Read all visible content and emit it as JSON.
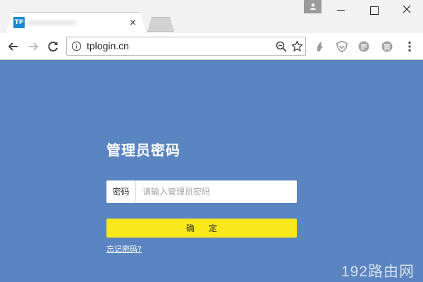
{
  "tab": {
    "favicon_text": "TP",
    "close_symbol": "×"
  },
  "window": {
    "profile_icon": "person-icon"
  },
  "address_bar": {
    "url": "tplogin.cn"
  },
  "page": {
    "title": "管理员密码",
    "password_label": "密码",
    "password_placeholder": "请输入管理员密码",
    "password_value": "",
    "confirm_label": "确定",
    "forgot_link": "忘记密码?"
  },
  "watermark": "192路由网",
  "colors": {
    "page_background": "#5b85c1",
    "button_yellow": "#f8e81c",
    "favicon_blue": "#1a8ad6"
  },
  "icons": [
    "back-arrow-icon",
    "forward-arrow-icon",
    "reload-icon",
    "info-icon",
    "zoom-icon",
    "star-icon",
    "extension-icon",
    "shield-icon",
    "menu-icon"
  ]
}
